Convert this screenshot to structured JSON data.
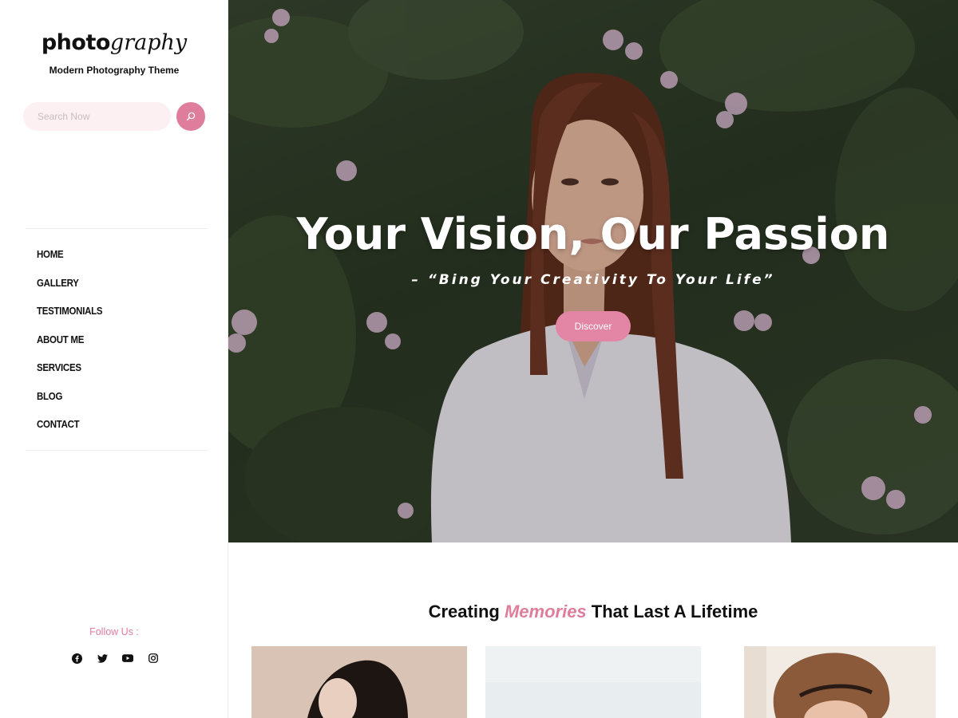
{
  "site": {
    "logo_bold": "photo",
    "logo_italic": "graphy",
    "tagline": "Modern Photography Theme"
  },
  "search": {
    "placeholder": "Search Now",
    "icon": "search-icon"
  },
  "nav": {
    "items": [
      {
        "label": "HOME"
      },
      {
        "label": "GALLERY"
      },
      {
        "label": "TESTIMONIALS"
      },
      {
        "label": "ABOUT ME"
      },
      {
        "label": "SERVICES"
      },
      {
        "label": "BLOG"
      },
      {
        "label": "CONTACT"
      }
    ]
  },
  "follow": {
    "label": "Follow Us :",
    "networks": [
      "facebook-icon",
      "twitter-icon",
      "youtube-icon",
      "instagram-icon"
    ]
  },
  "hero": {
    "title": "Your Vision, Our Passion",
    "subtitle": "– “Bing Your Creativity To Your Life”",
    "button_label": "Discover"
  },
  "section": {
    "title_before": "Creating ",
    "title_accent": "Memories",
    "title_after": " That Last A Lifetime"
  },
  "colors": {
    "accent": "#df7d9c",
    "search_bg": "#fcf0f2",
    "text": "#111111"
  }
}
